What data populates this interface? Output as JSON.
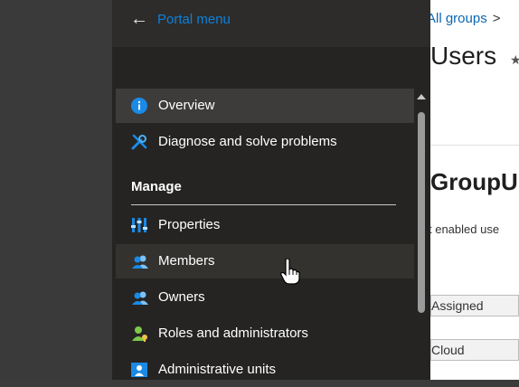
{
  "portal_menu": {
    "back_icon": "back-arrow-icon",
    "label": "Portal menu"
  },
  "nav": {
    "overview": {
      "label": "Overview",
      "icon": "info-icon"
    },
    "diagnose": {
      "label": "Diagnose and solve problems",
      "icon": "wrench-icon"
    },
    "section_manage": "Manage",
    "properties": {
      "label": "Properties",
      "icon": "properties-icon"
    },
    "members": {
      "label": "Members",
      "icon": "members-icon"
    },
    "owners": {
      "label": "Owners",
      "icon": "owners-icon"
    },
    "roles": {
      "label": "Roles and administrators",
      "icon": "roles-icon"
    },
    "admin_units": {
      "label": "Administrative units",
      "icon": "admin-units-icon"
    }
  },
  "background": {
    "breadcrumb": "All groups",
    "breadcrumb_sep": ">",
    "page_title": "Users",
    "group_heading": "GroupU",
    "sub_text": "t enabled use",
    "membership_type": "Assigned",
    "source": "Cloud"
  },
  "colors": {
    "accent": "#0d80d8",
    "menu_bg": "#252423",
    "selected_bg": "#3d3c3b"
  }
}
